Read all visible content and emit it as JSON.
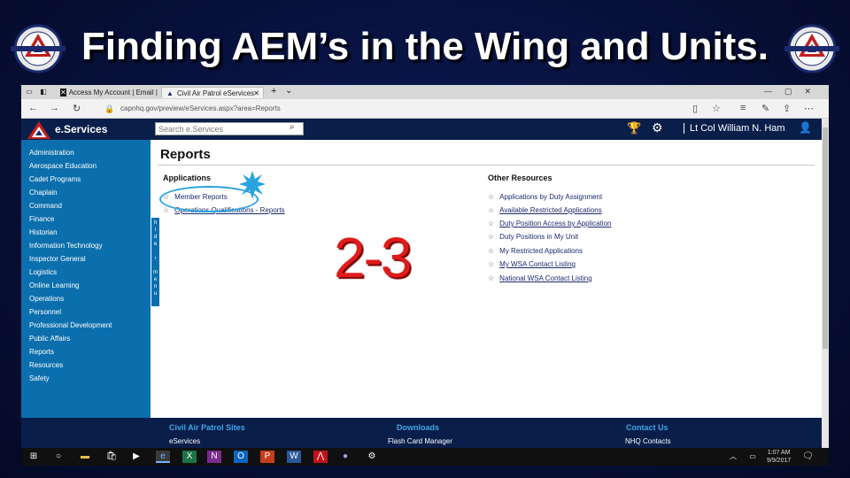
{
  "slide": {
    "title": "Finding AEM’s in the Wing and Units.",
    "logo_text": "CIVIL AIR PATROL"
  },
  "browser": {
    "tabs": [
      {
        "icon": "x-icon",
        "label": "Access My Account | Email |"
      },
      {
        "icon": "cap-icon",
        "label": "Civil Air Patrol eServices",
        "close": "✕"
      }
    ],
    "new_tab": "+",
    "tab_menu": "⌄",
    "url": "capnhq.gov/preview/eServices.aspx?area=Reports"
  },
  "header": {
    "brand": "e.Services",
    "search_placeholder": "Search e.Services",
    "user": "Lt Col William N. Ham"
  },
  "sidebar": {
    "items": [
      "Administration",
      "Aerospace Education",
      "Cadet Programs",
      "Chaplain",
      "Command",
      "Finance",
      "Historian",
      "Information Technology",
      "Inspector General",
      "Logistics",
      "Online Learning",
      "Operations",
      "Personnel",
      "Professional Development",
      "Public Affairs",
      "Reports",
      "Resources",
      "Safety"
    ],
    "collapse_label": "Hide menu"
  },
  "main": {
    "title": "Reports",
    "applications": {
      "heading": "Applications",
      "items": [
        "Member Reports",
        "Operations Qualifications - Reports"
      ]
    },
    "other": {
      "heading": "Other Resources",
      "items": [
        "Applications by Duty Assignment",
        "Available Restricted Applications",
        "Duty Position Access by Application",
        "Duty Positions in My Unit",
        "My Restricted Applications",
        "My WSA Contact Listing",
        "National WSA Contact Listing"
      ]
    },
    "annotation": "2-3"
  },
  "footer": {
    "columns": [
      {
        "heading": "Civil Air Patrol Sites",
        "link": "eServices"
      },
      {
        "heading": "Downloads",
        "link": "Flash Card Manager"
      },
      {
        "heading": "Contact Us",
        "link": "NHQ Contacts"
      }
    ]
  },
  "taskbar": {
    "time": "1:07 AM",
    "date": "9/9/2017"
  },
  "colors": {
    "slide_bg": "#07103a",
    "header_navy": "#0a1e4a",
    "sidebar_blue": "#0c6fad",
    "annotation_red": "#e01b1b",
    "circle_blue": "#2aa3e0"
  }
}
